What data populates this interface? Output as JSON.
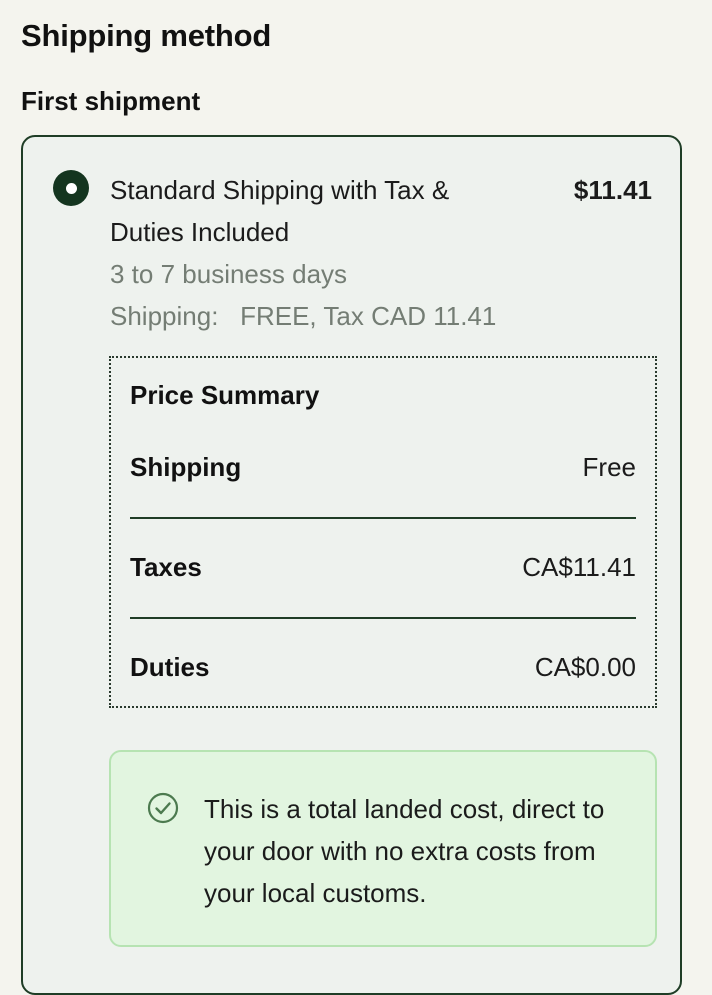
{
  "header": {
    "title": "Shipping method",
    "subtitle": "First shipment"
  },
  "option": {
    "name": "Standard Shipping with Tax & Duties Included",
    "price": "$11.41",
    "eta": "3 to 7 business days",
    "detail": "Shipping:   FREE, Tax CAD 11.41",
    "selected": true
  },
  "summary": {
    "title": "Price Summary",
    "rows": [
      {
        "label": "Shipping",
        "value": "Free"
      },
      {
        "label": "Taxes",
        "value": "CA$11.41"
      },
      {
        "label": "Duties",
        "value": "CA$0.00"
      }
    ]
  },
  "notice": {
    "icon": "check-circle-icon",
    "text": "This is a total landed cost, direct to your door with no extra costs from your local customs."
  },
  "colors": {
    "accent": "#14351f",
    "notice_bg": "#e2f5e0",
    "muted_text": "#747d74"
  }
}
